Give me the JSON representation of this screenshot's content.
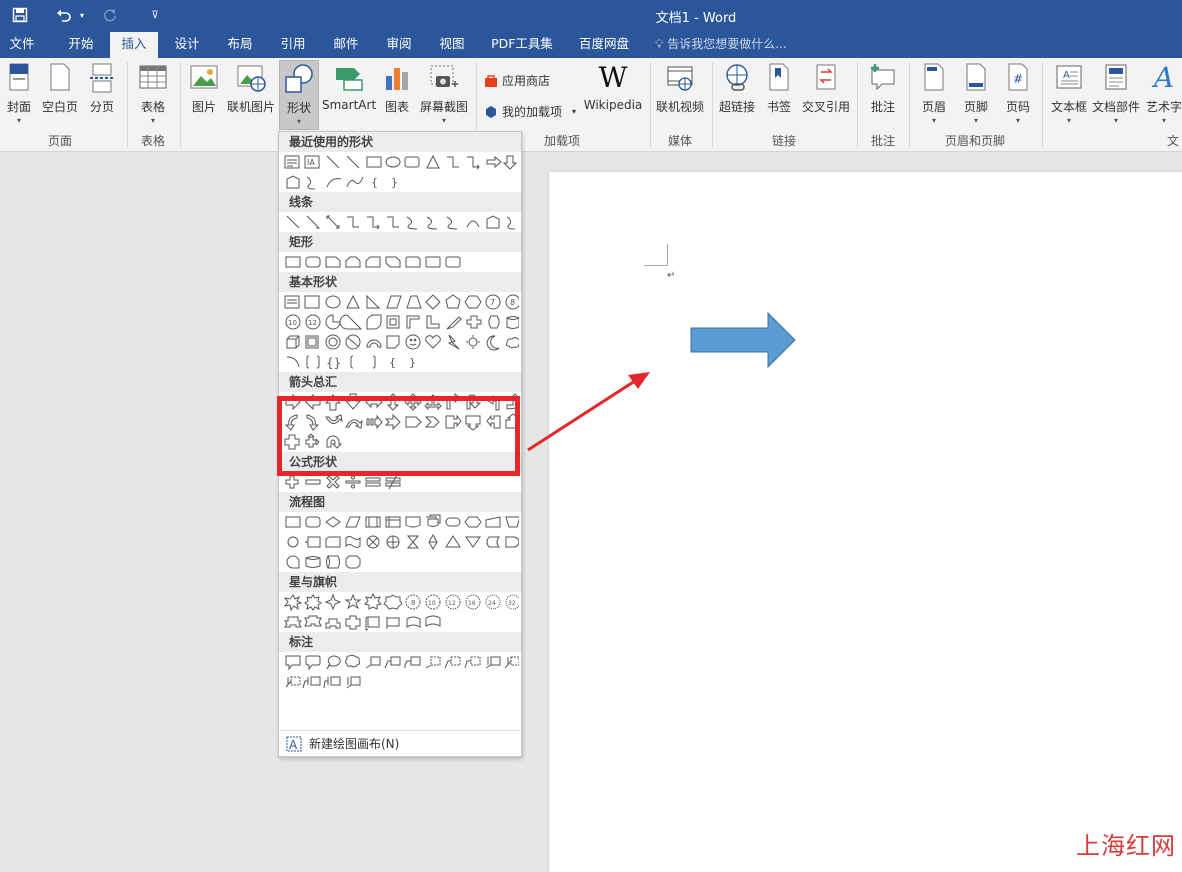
{
  "app": {
    "title": "文档1 - Word"
  },
  "quick_access": {
    "save_icon": "save-icon",
    "undo_icon": "undo-icon",
    "redo_icon": "redo-icon",
    "customize_icon": "customize-icon"
  },
  "tabs": [
    "文件",
    "开始",
    "插入",
    "设计",
    "布局",
    "引用",
    "邮件",
    "审阅",
    "视图",
    "PDF工具集",
    "百度网盘"
  ],
  "active_tab": "插入",
  "tell_me": "告诉我您想要做什么...",
  "ribbon": {
    "pages": {
      "cover": "封面",
      "blank": "空白页",
      "break": "分页",
      "group": "页面"
    },
    "tables": {
      "table": "表格",
      "group": "表格"
    },
    "illustrations": {
      "picture": "图片",
      "online_picture": "联机图片",
      "shapes": "形状",
      "smartart": "SmartArt",
      "chart": "图表",
      "screenshot": "屏幕截图"
    },
    "addins": {
      "store": "应用商店",
      "my_addins": "我的加载项",
      "wikipedia": "Wikipedia",
      "group": "加载项"
    },
    "media": {
      "online_video": "联机视频",
      "group": "媒体"
    },
    "links": {
      "hyperlink": "超链接",
      "bookmark": "书签",
      "cross_ref": "交叉引用",
      "group": "链接"
    },
    "comments": {
      "comment": "批注",
      "group": "批注"
    },
    "header_footer": {
      "header": "页眉",
      "footer": "页脚",
      "page_number": "页码",
      "group": "页眉和页脚"
    },
    "text": {
      "textbox": "文本框",
      "quick_parts": "文档部件",
      "wordart": "艺术字",
      "group": "文"
    }
  },
  "shapes_menu": {
    "sections": [
      {
        "title": "最近使用的形状"
      },
      {
        "title": "线条"
      },
      {
        "title": "矩形"
      },
      {
        "title": "基本形状"
      },
      {
        "title": "箭头总汇"
      },
      {
        "title": "公式形状"
      },
      {
        "title": "流程图"
      },
      {
        "title": "星与旗帜"
      },
      {
        "title": "标注"
      }
    ],
    "new_canvas": "新建绘图画布(N)"
  },
  "colors": {
    "accent": "#2b579a",
    "shape_fill": "#5b9bd5",
    "highlight": "#e5262a"
  },
  "watermark": "上海红网"
}
